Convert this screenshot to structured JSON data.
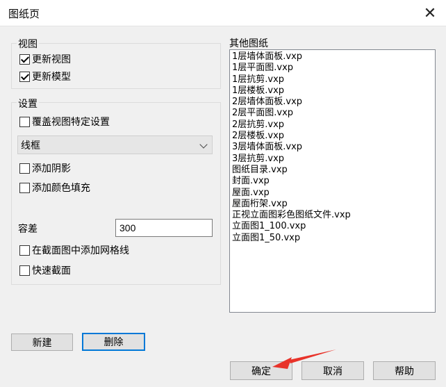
{
  "window": {
    "title": "图纸页",
    "close_glyph": "✕"
  },
  "view_group": {
    "legend": "视图",
    "update_view": {
      "label": "更新视图",
      "checked": true
    },
    "update_model": {
      "label": "更新模型",
      "checked": true
    }
  },
  "settings_group": {
    "legend": "设置",
    "override_view_settings": {
      "label": "覆盖视图特定设置",
      "checked": false
    },
    "render_mode": {
      "value": "线框"
    },
    "add_shadow": {
      "label": "添加阴影",
      "checked": false
    },
    "add_color_fill": {
      "label": "添加颜色填充",
      "checked": false
    },
    "tolerance": {
      "label": "容差",
      "value": "300"
    },
    "add_grid_lines": {
      "label": "在截面图中添加网格线",
      "checked": false
    },
    "quick_section": {
      "label": "快速截面",
      "checked": false
    }
  },
  "other_drawings": {
    "legend": "其他图纸",
    "items": [
      "1层墙体面板.vxp",
      "1层平面图.vxp",
      "1层抗剪.vxp",
      "1层楼板.vxp",
      "2层墙体面板.vxp",
      "2层平面图.vxp",
      "2层抗剪.vxp",
      "2层楼板.vxp",
      "3层墙体面板.vxp",
      "3层抗剪.vxp",
      "图纸目录.vxp",
      "封面.vxp",
      "屋面.vxp",
      "屋面桁架.vxp",
      "正视立面图彩色图纸文件.vxp",
      "立面图1_100.vxp",
      "立面图1_50.vxp"
    ]
  },
  "buttons": {
    "new": "新建",
    "delete": "删除",
    "ok": "确定",
    "cancel": "取消",
    "help": "帮助"
  },
  "annotation": {
    "arrow_color": "#e8332a"
  }
}
